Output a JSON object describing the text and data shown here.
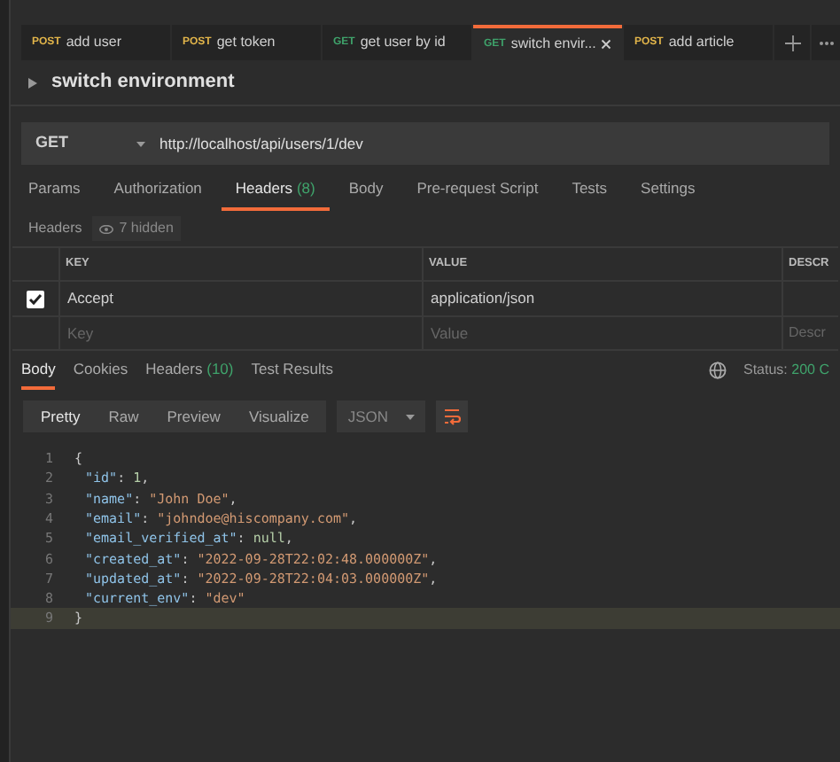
{
  "request_tabs": [
    {
      "method": "POST",
      "name": "add user",
      "selected": false,
      "closable": false
    },
    {
      "method": "POST",
      "name": "get token",
      "selected": false,
      "closable": false
    },
    {
      "method": "GET",
      "name": "get user by id",
      "selected": false,
      "closable": false
    },
    {
      "method": "GET",
      "name": "switch envir...",
      "selected": true,
      "closable": true
    },
    {
      "method": "POST",
      "name": "add article",
      "selected": false,
      "closable": false
    }
  ],
  "request_title": "switch environment",
  "url_bar": {
    "method": "GET",
    "url": "http://localhost/api/users/1/dev"
  },
  "request_sections": [
    {
      "label": "Params",
      "selected": false
    },
    {
      "label": "Authorization",
      "selected": false
    },
    {
      "label": "Headers",
      "count": "(8)",
      "selected": true
    },
    {
      "label": "Body",
      "selected": false
    },
    {
      "label": "Pre-request Script",
      "selected": false
    },
    {
      "label": "Tests",
      "selected": false
    },
    {
      "label": "Settings",
      "selected": false
    }
  ],
  "headers_bar": {
    "label": "Headers",
    "hidden": "7 hidden"
  },
  "headers_table": {
    "columns": [
      "KEY",
      "VALUE",
      "DESCR"
    ],
    "rows": [
      {
        "checked": true,
        "key": "Accept",
        "value": "application/json"
      }
    ],
    "new_row": {
      "key_placeholder": "Key",
      "value_placeholder": "Value",
      "description_placeholder": "Descr"
    }
  },
  "response_tabs": [
    {
      "label": "Body",
      "selected": true
    },
    {
      "label": "Cookies",
      "selected": false
    },
    {
      "label": "Headers",
      "count": "(10)",
      "selected": false
    },
    {
      "label": "Test Results",
      "selected": false
    }
  ],
  "status": {
    "label": "Status:",
    "value": "200 C"
  },
  "view_modes": [
    {
      "label": "Pretty",
      "selected": true
    },
    {
      "label": "Raw",
      "selected": false
    },
    {
      "label": "Preview",
      "selected": false
    },
    {
      "label": "Visualize",
      "selected": false
    }
  ],
  "format": "JSON",
  "code_lines": [
    {
      "number": "1",
      "current": false,
      "tokens": [
        {
          "text": "{",
          "kind": "punct"
        }
      ]
    },
    {
      "number": "2",
      "current": false,
      "tokens": [
        {
          "text": "\"id\"",
          "kind": "key"
        },
        {
          "text": ": ",
          "kind": "punct"
        },
        {
          "text": "1",
          "kind": "number"
        },
        {
          "text": ",",
          "kind": "punct"
        }
      ]
    },
    {
      "number": "3",
      "current": false,
      "tokens": [
        {
          "text": "\"name\"",
          "kind": "key"
        },
        {
          "text": ": ",
          "kind": "punct"
        },
        {
          "text": "\"John Doe\"",
          "kind": "string"
        },
        {
          "text": ",",
          "kind": "punct"
        }
      ]
    },
    {
      "number": "4",
      "current": false,
      "tokens": [
        {
          "text": "\"email\"",
          "kind": "key"
        },
        {
          "text": ": ",
          "kind": "punct"
        },
        {
          "text": "\"johndoe@hiscompany.com\"",
          "kind": "string"
        },
        {
          "text": ",",
          "kind": "punct"
        }
      ]
    },
    {
      "number": "5",
      "current": false,
      "tokens": [
        {
          "text": "\"email_verified_at\"",
          "kind": "key"
        },
        {
          "text": ": ",
          "kind": "punct"
        },
        {
          "text": "null",
          "kind": "number"
        },
        {
          "text": ",",
          "kind": "punct"
        }
      ]
    },
    {
      "number": "6",
      "current": false,
      "tokens": [
        {
          "text": "\"created_at\"",
          "kind": "key"
        },
        {
          "text": ": ",
          "kind": "punct"
        },
        {
          "text": "\"2022-09-28T22:02:48.000000Z\"",
          "kind": "string"
        },
        {
          "text": ",",
          "kind": "punct"
        }
      ]
    },
    {
      "number": "7",
      "current": false,
      "tokens": [
        {
          "text": "\"updated_at\"",
          "kind": "key"
        },
        {
          "text": ": ",
          "kind": "punct"
        },
        {
          "text": "\"2022-09-28T22:04:03.000000Z\"",
          "kind": "string"
        },
        {
          "text": ",",
          "kind": "punct"
        }
      ]
    },
    {
      "number": "8",
      "current": false,
      "tokens": [
        {
          "text": "\"current_env\"",
          "kind": "key"
        },
        {
          "text": ": ",
          "kind": "punct"
        },
        {
          "text": "\"dev\"",
          "kind": "string"
        }
      ]
    },
    {
      "number": "9",
      "current": true,
      "tokens": [
        {
          "text": "}",
          "kind": "punct"
        }
      ]
    }
  ]
}
